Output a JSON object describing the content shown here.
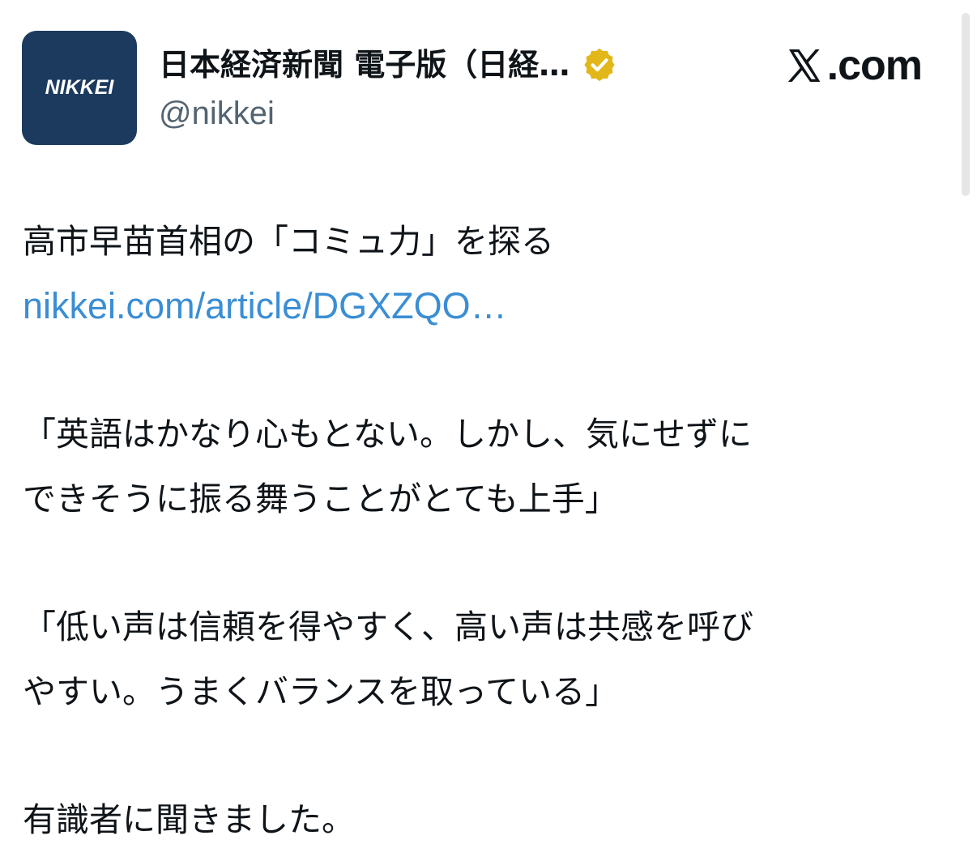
{
  "account": {
    "avatar_text": "NIKKEI",
    "display_name": "日本経済新聞 電子版（日経…",
    "handle": "@nikkei",
    "verified_icon": "verified-gold-badge-icon",
    "avatar_color": "#1c3a5e",
    "badge_color": "#e2b719"
  },
  "site": {
    "label": ".com",
    "icon": "x-logo-icon"
  },
  "tweet": {
    "line1": "高市早苗首相の「コミュ力」を探る",
    "link": "nikkei.com/article/DGXZQO…",
    "quote1_line1": "「英語はかなり心もとない。しかし、気にせずに",
    "quote1_line2": "できそうに振る舞うことがとても上手」",
    "quote2_line1": "「低い声は信頼を得やすく、高い声は共感を呼び",
    "quote2_line2": "やすい。うまくバランスを取っている」",
    "closing": "有識者に聞きました。",
    "link_color": "#3b8ed4"
  }
}
